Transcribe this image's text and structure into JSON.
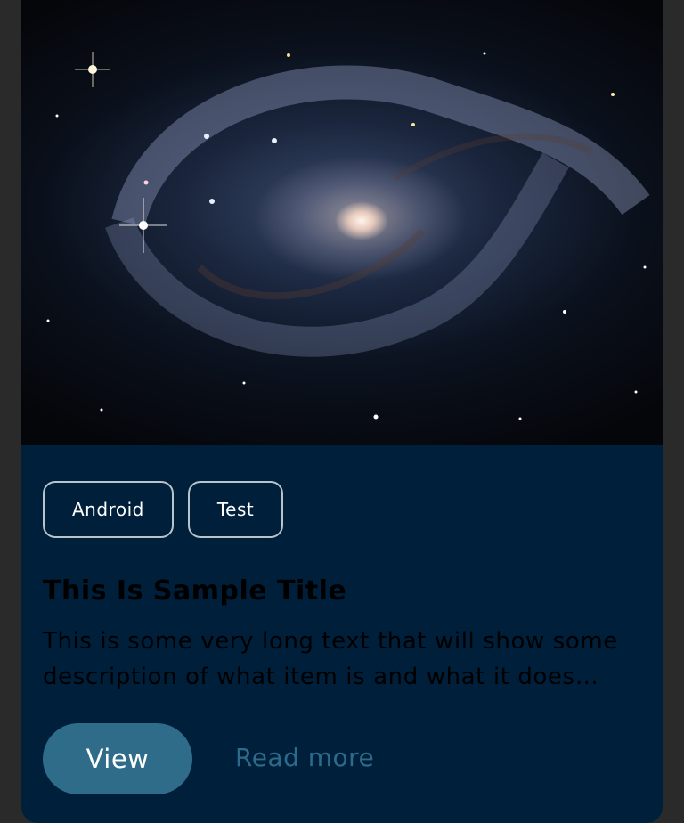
{
  "card": {
    "image_description_icon": "galaxy-image",
    "tags": [
      "Android",
      "Test"
    ],
    "title": "This Is Sample Title",
    "description": "This is some very long text that will show some description of what item is and what it does when the user taps on it",
    "view_label": "View",
    "read_more_label": "Read more"
  },
  "colors": {
    "card_bg": "#001f3a",
    "page_bg": "#2a2a2a",
    "view_button_bg": "#2e6c8a",
    "read_more": "#2c6b8c",
    "tag_border": "#b9c3cc"
  }
}
